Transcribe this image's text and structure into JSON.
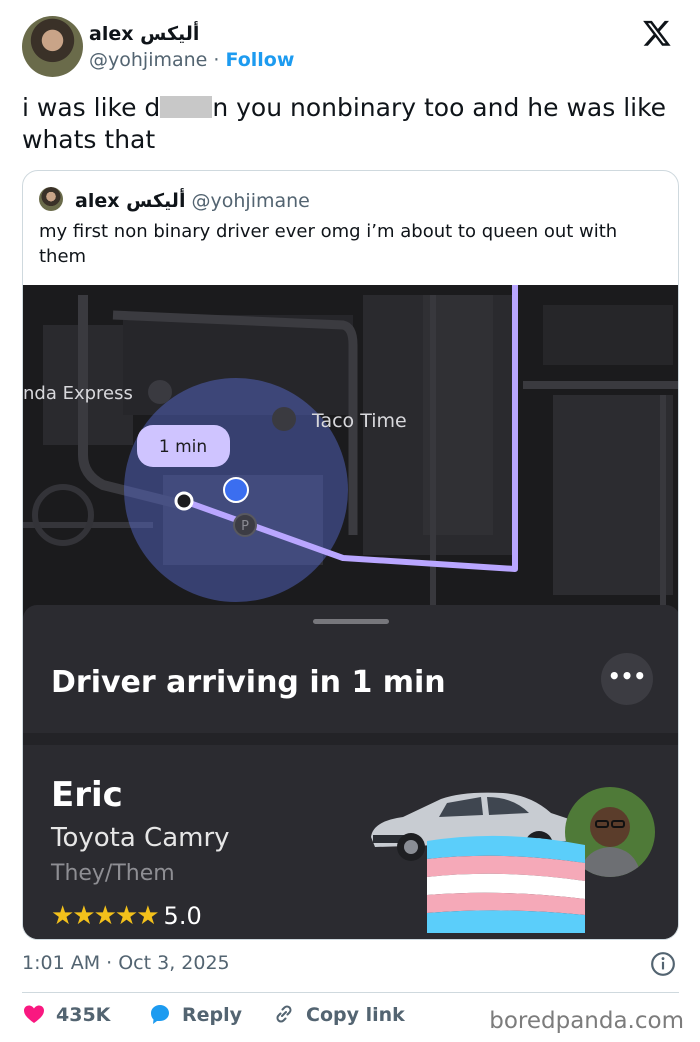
{
  "author": {
    "name": "alex أليكس",
    "handle": "@yohjimane",
    "dot": "·",
    "follow_label": "Follow"
  },
  "tweet": {
    "text_before_censor": "i was like d",
    "text_after_censor": "n you nonbinary too and he was like whats that"
  },
  "quote": {
    "name": "alex أليكس",
    "handle": "@yohjimane",
    "text": "my first non binary driver ever omg  i’m about to queen out with them"
  },
  "screenshot": {
    "map_labels": {
      "panda_express": "nda Express",
      "taco_time": "Taco Time",
      "eta_bubble": "1 min",
      "parking": "P"
    },
    "sheet": {
      "arriving": "Driver arriving in 1 min",
      "more_icon": "•••",
      "driver_name": "Eric",
      "car": "Toyota Camry",
      "pronouns": "They/Them",
      "stars": "★★★★★",
      "rating": "5.0"
    }
  },
  "timestamp": "1:01 AM · Oct 3, 2025",
  "actions": {
    "likes": "435K",
    "reply": "Reply",
    "copy_link": "Copy link"
  },
  "watermark": "boredpanda.com",
  "colors": {
    "follow": "#1d9bf0",
    "like_heart": "#f91880",
    "reply_bubble": "#1d9bf0",
    "route": "#b9a6ff"
  }
}
